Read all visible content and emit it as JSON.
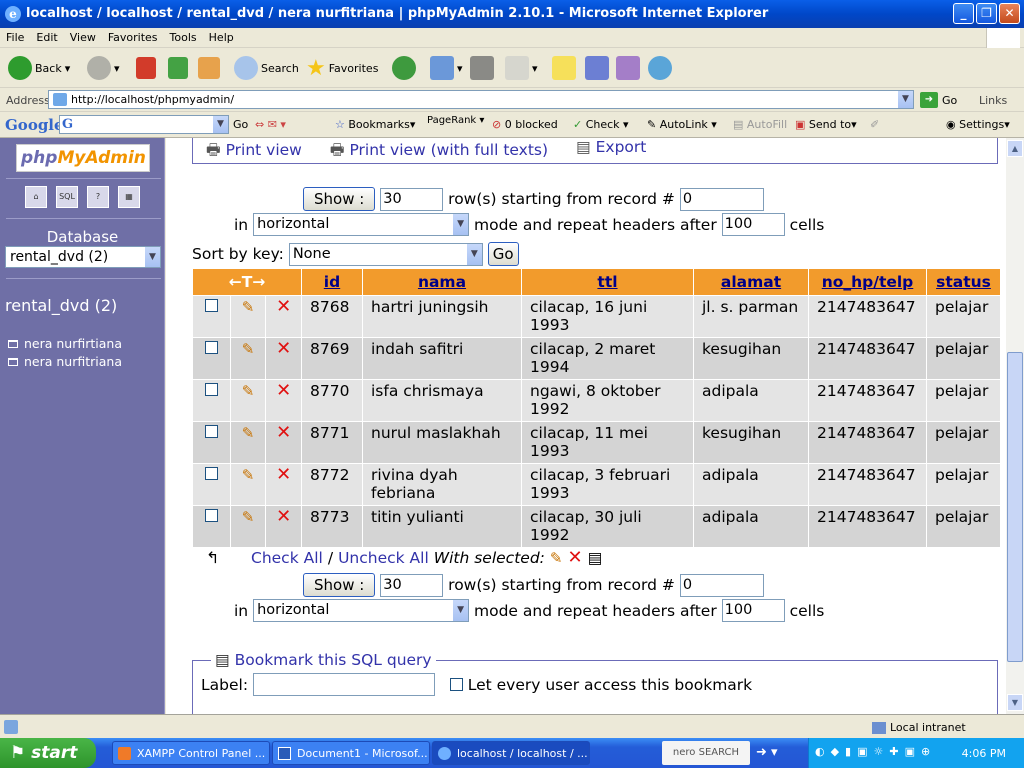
{
  "window": {
    "title": "localhost / localhost / rental_dvd / nera nurfitriana | phpMyAdmin 2.10.1 - Microsoft Internet Explorer"
  },
  "menu": [
    "File",
    "Edit",
    "View",
    "Favorites",
    "Tools",
    "Help"
  ],
  "toolbar": {
    "back": "Back",
    "search": "Search",
    "favorites": "Favorites"
  },
  "address": {
    "label": "Address",
    "url": "http://localhost/phpmyadmin/",
    "go": "Go",
    "links": "Links"
  },
  "googlebar": {
    "logo": "Google",
    "go": "Go",
    "bookmarks": "Bookmarks",
    "pagerank": "PageRank",
    "blocked": "0 blocked",
    "check": "Check",
    "autolink": "AutoLink",
    "autofill": "AutoFill",
    "sendto": "Send to",
    "settings": "Settings"
  },
  "left": {
    "logo_a": "php",
    "logo_b": "MyAdmin",
    "icons": [
      "home-icon",
      "sql-icon",
      "help-icon",
      "query-icon"
    ],
    "database_label": "Database",
    "database_select": "rental_dvd (2)",
    "db_name": "rental_dvd (2)",
    "tables": [
      "nera nurfirtiana",
      "nera nurfitriana"
    ]
  },
  "top_links": {
    "print": "Print view",
    "print_full": "Print view (with full texts)",
    "export": "Export"
  },
  "nav_top": {
    "show": "Show :",
    "rows": "30",
    "rows_text": "row(s) starting from record #",
    "start": "0",
    "in": "in",
    "mode": "horizontal",
    "mode_text": "mode and repeat headers after",
    "repeat": "100",
    "cells": "cells"
  },
  "sort": {
    "label": "Sort by key:",
    "value": "None",
    "go": "Go"
  },
  "table": {
    "columns": [
      "id",
      "nama",
      "ttl",
      "alamat",
      "no_hp/telp",
      "status"
    ],
    "rows": [
      {
        "id": "8768",
        "nama": "hartri juningsih",
        "ttl": "cilacap, 16 juni 1993",
        "alamat": "jl. s. parman",
        "hp": "2147483647",
        "status": "pelajar"
      },
      {
        "id": "8769",
        "nama": "indah safitri",
        "ttl": "cilacap, 2 maret 1994",
        "alamat": "kesugihan",
        "hp": "2147483647",
        "status": "pelajar"
      },
      {
        "id": "8770",
        "nama": "isfa chrismaya",
        "ttl": "ngawi, 8 oktober 1992",
        "alamat": "adipala",
        "hp": "2147483647",
        "status": "pelajar"
      },
      {
        "id": "8771",
        "nama": "nurul maslakhah",
        "ttl": "cilacap, 11 mei 1993",
        "alamat": "kesugihan",
        "hp": "2147483647",
        "status": "pelajar"
      },
      {
        "id": "8772",
        "nama": "rivina dyah febriana",
        "ttl": "cilacap, 3 februari 1993",
        "alamat": "adipala",
        "hp": "2147483647",
        "status": "pelajar"
      },
      {
        "id": "8773",
        "nama": "titin yulianti",
        "ttl": "cilacap, 30 juli 1992",
        "alamat": "adipala",
        "hp": "2147483647",
        "status": "pelajar"
      }
    ]
  },
  "checkall": {
    "check": "Check All",
    "sep": "/",
    "uncheck": "Uncheck All",
    "with": "With selected:"
  },
  "nav_bottom": {
    "show": "Show :",
    "rows": "30",
    "rows_text": "row(s) starting from record #",
    "start": "0",
    "in": "in",
    "mode": "horizontal",
    "mode_text": "mode and repeat headers after",
    "repeat": "100",
    "cells": "cells"
  },
  "bookmark": {
    "legend": "Bookmark this SQL query",
    "label": "Label:",
    "let_every": "Let every user access this bookmark"
  },
  "status": {
    "zone": "Local intranet"
  },
  "taskbar": {
    "start": "start",
    "tasks": [
      "XAMPP Control Panel ...",
      "Document1 - Microsof...",
      "localhost / localhost / ..."
    ],
    "nero": "nero SEARCH",
    "time": "4:06 PM"
  }
}
